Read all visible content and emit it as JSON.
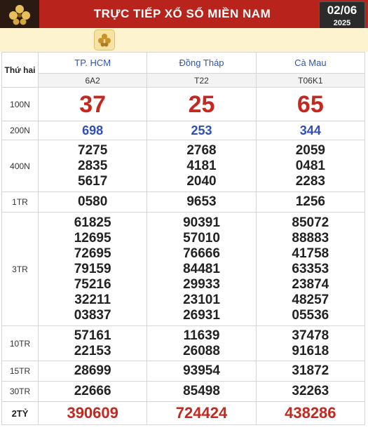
{
  "header": {
    "title": "TRỰC TIẾP XỔ SỐ MIỀN NAM",
    "date_day": "02/06",
    "date_year": "2025",
    "logo_icon": "flower-logo-icon"
  },
  "table": {
    "day_label": "Thứ hai",
    "provinces": [
      {
        "name": "TP. HCM",
        "code": "6A2"
      },
      {
        "name": "Đồng Tháp",
        "code": "T22"
      },
      {
        "name": "Cà Mau",
        "code": "T06K1"
      }
    ],
    "rows": [
      {
        "label": "100N",
        "cells": [
          [
            "37"
          ],
          [
            "25"
          ],
          [
            "65"
          ]
        ]
      },
      {
        "label": "200N",
        "cells": [
          [
            "698"
          ],
          [
            "253"
          ],
          [
            "344"
          ]
        ]
      },
      {
        "label": "400N",
        "cells": [
          [
            "7275",
            "2835",
            "5617"
          ],
          [
            "2768",
            "4181",
            "2040"
          ],
          [
            "2059",
            "0481",
            "2283"
          ]
        ]
      },
      {
        "label": "1TR",
        "cells": [
          [
            "0580"
          ],
          [
            "9653"
          ],
          [
            "1256"
          ]
        ]
      },
      {
        "label": "3TR",
        "cells": [
          [
            "61825",
            "12695",
            "72695",
            "79159",
            "75216",
            "32211",
            "03837"
          ],
          [
            "90391",
            "57010",
            "76666",
            "84481",
            "29933",
            "23101",
            "26931"
          ],
          [
            "85072",
            "88883",
            "41758",
            "63353",
            "23874",
            "48257",
            "05536"
          ]
        ]
      },
      {
        "label": "10TR",
        "cells": [
          [
            "57161",
            "22153"
          ],
          [
            "11639",
            "26088"
          ],
          [
            "37478",
            "91618"
          ]
        ]
      },
      {
        "label": "15TR",
        "cells": [
          [
            "28699"
          ],
          [
            "93954"
          ],
          [
            "31872"
          ]
        ]
      },
      {
        "label": "30TR",
        "cells": [
          [
            "22666"
          ],
          [
            "85498"
          ],
          [
            "32263"
          ]
        ]
      },
      {
        "label": "2TỶ",
        "cells": [
          [
            "390609"
          ],
          [
            "724424"
          ],
          [
            "438286"
          ]
        ]
      }
    ]
  }
}
